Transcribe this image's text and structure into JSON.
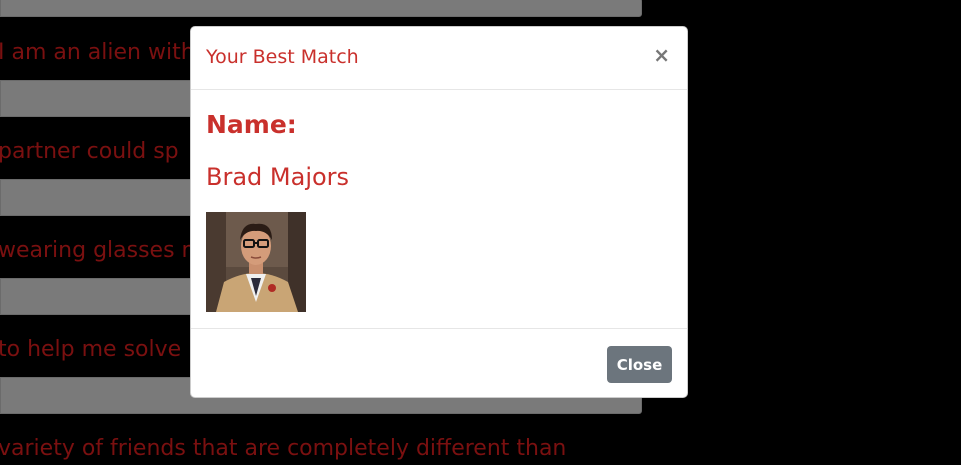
{
  "background": {
    "questions": [
      "I am an alien with",
      "partner could sp",
      "wearing glasses m",
      "to help me solve",
      "variety of friends that are completely different than"
    ]
  },
  "modal": {
    "title": "Your Best Match",
    "close_icon_glyph": "×",
    "name_label": "Name:",
    "match_name": "Brad Majors",
    "photo_icon": "profile-photo",
    "close_button_label": "Close"
  },
  "colors": {
    "accent": "#c9302c",
    "button": "#6c757d",
    "background_text": "#7a1010",
    "background_bar": "#7a7a7a"
  }
}
